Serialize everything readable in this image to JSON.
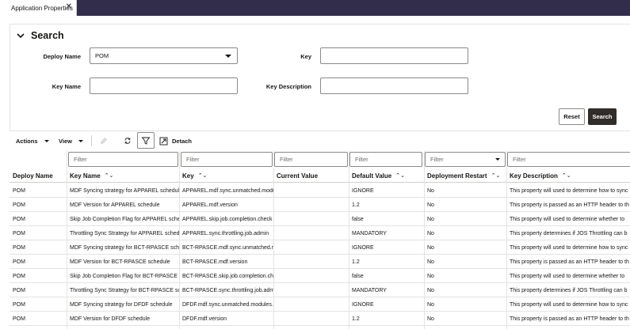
{
  "tab": {
    "title": "Application Properties",
    "close_symbol": "✕"
  },
  "search": {
    "title": "Search",
    "deploy_name_label": "Deploy Name",
    "deploy_name_value": "POM",
    "key_label": "Key",
    "key_value": "",
    "key_name_label": "Key Name",
    "key_name_value": "",
    "key_description_label": "Key Description",
    "key_description_value": "",
    "reset_label": "Reset",
    "search_label": "Search"
  },
  "toolbar": {
    "actions_label": "Actions",
    "view_label": "View",
    "detach_label": "Detach",
    "icons": [
      "edit-icon",
      "refresh-icon",
      "filter-icon",
      "detach-icon"
    ]
  },
  "table": {
    "filter_placeholder": "Filter",
    "columns": [
      "Deploy Name",
      "Key Name",
      "Key",
      "Current Value",
      "Default Value",
      "Deployment Restart",
      "Key Description"
    ],
    "sort_symbol": "⌃⌄",
    "rows": [
      [
        "POM",
        "MDF Syncing strategy for APPAREL schedule",
        "APPAREL.mdf.sync.unmatched.modules",
        "",
        "IGNORE",
        "No",
        "This property will used to determine how to sync"
      ],
      [
        "POM",
        "MDF Version for APPAREL schedule",
        "APPAREL.mdf.version",
        "",
        "1.2",
        "No",
        "This property is passed as an HTTP header to th"
      ],
      [
        "POM",
        "Skip Job Completion Flag for APPAREL schedule",
        "APPAREL.skip.job.completion.check",
        "",
        "false",
        "No",
        "This property will used to determine whether to"
      ],
      [
        "POM",
        "Throttling Sync Strategy for APPAREL schedule",
        "APPAREL.sync.throttling.job.admin",
        "",
        "MANDATORY",
        "No",
        "This property determines if JOS Throttling can b"
      ],
      [
        "POM",
        "MDF Syncing strategy for BCT-RPASCE schedule",
        "BCT-RPASCE.mdf.sync.unmatched.moc",
        "",
        "IGNORE",
        "No",
        "This property will used to determine how to sync"
      ],
      [
        "POM",
        "MDF Version for BCT-RPASCE schedule",
        "BCT-RPASCE.mdf.version",
        "",
        "1.2",
        "No",
        "This property is passed as an HTTP header to th"
      ],
      [
        "POM",
        "Skip Job Completion Flag for BCT-RPASCE sche",
        "BCT-RPASCE.skip.job.completion.check",
        "",
        "false",
        "No",
        "This property will used to determine whether to"
      ],
      [
        "POM",
        "Throttling Sync Strategy for BCT-RPASCE sched",
        "BCT-RPASCE.sync.throttling.job.admin",
        "",
        "MANDATORY",
        "No",
        "This property determines if JOS Throttling can b"
      ],
      [
        "POM",
        "MDF Syncing strategy for DFDF schedule",
        "DFDF.mdf.sync.unmatched.modules.re",
        "",
        "IGNORE",
        "No",
        "This property will used to determine how to sync"
      ],
      [
        "POM",
        "MDF Version for DFDF schedule",
        "DFDF.mdf.version",
        "",
        "1.2",
        "No",
        "This property is passed as an HTTP header to th"
      ]
    ]
  }
}
